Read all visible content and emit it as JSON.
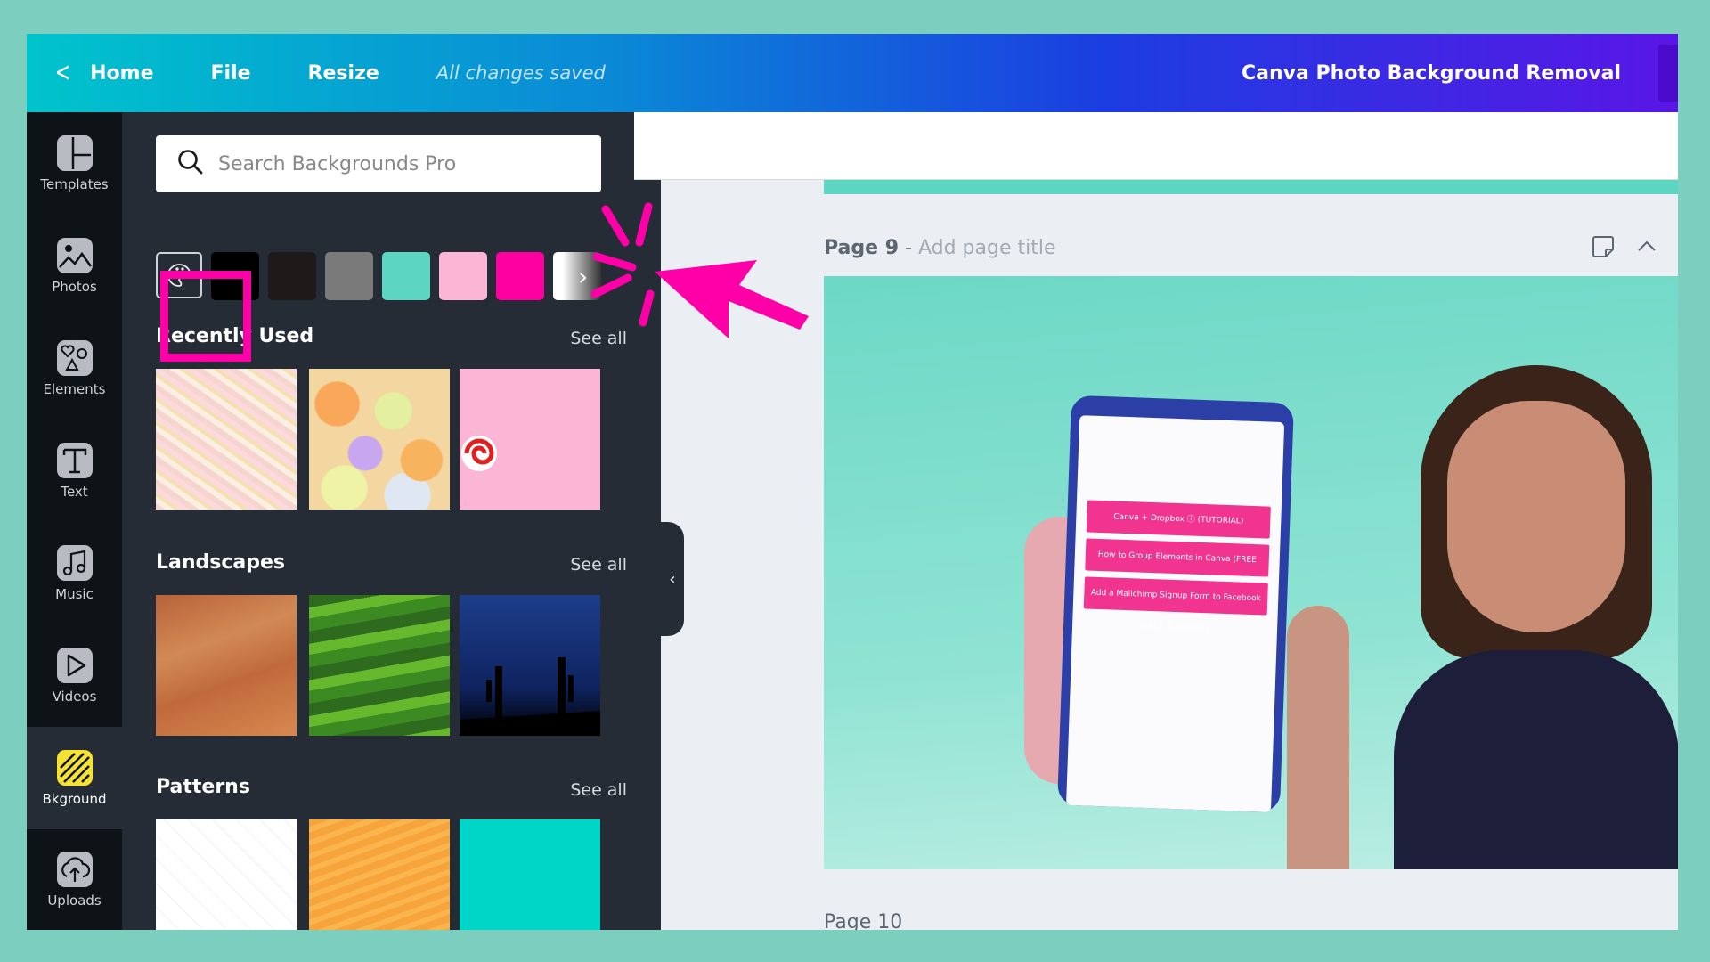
{
  "header": {
    "back_label": "Home",
    "file_label": "File",
    "resize_label": "Resize",
    "save_status": "All changes saved",
    "document_title": "Canva Photo Background Removal"
  },
  "rail": {
    "items": [
      {
        "label": "Templates",
        "icon": "templates-icon"
      },
      {
        "label": "Photos",
        "icon": "photos-icon"
      },
      {
        "label": "Elements",
        "icon": "elements-icon"
      },
      {
        "label": "Text",
        "icon": "text-icon"
      },
      {
        "label": "Music",
        "icon": "music-icon"
      },
      {
        "label": "Videos",
        "icon": "videos-icon"
      },
      {
        "label": "Bkground",
        "icon": "background-icon",
        "active": true
      },
      {
        "label": "Uploads",
        "icon": "uploads-icon"
      }
    ]
  },
  "panel": {
    "search_placeholder": "Search Backgrounds Pro",
    "swatches": [
      {
        "name": "black",
        "color": "#000000"
      },
      {
        "name": "dark-brown",
        "color": "#1e1a1a"
      },
      {
        "name": "gray",
        "color": "#7a7a7a"
      },
      {
        "name": "turquoise",
        "color": "#5cd6c2"
      },
      {
        "name": "light-pink",
        "color": "#fbb6d6"
      },
      {
        "name": "hot-pink",
        "color": "#ff00a0"
      },
      {
        "name": "white-gradient",
        "color": "#ffffff"
      }
    ],
    "sections": [
      {
        "title": "Recently Used",
        "see_all": "See all",
        "thumbnails": [
          "marshmallows",
          "candy-hearts",
          "pink-lollipop"
        ]
      },
      {
        "title": "Landscapes",
        "see_all": "See all",
        "thumbnails": [
          "desert-dunes",
          "green-hills",
          "starry-cactus-night"
        ]
      },
      {
        "title": "Patterns",
        "see_all": "See all",
        "thumbnails": [
          "white-geometric",
          "orange-zigzag",
          "turquoise"
        ]
      }
    ]
  },
  "canvas": {
    "page_label": "Page 9",
    "page_separator": " - ",
    "page_title_placeholder": "Add page title",
    "next_page_label": "Page 10",
    "page_background_color": "#7fdccb",
    "phone_buttons": [
      "Canva + Dropbox ⓘ (TUTORIAL)",
      "How to Group Elements in Canva (FREE TUTORIAL)",
      "Add a Mailchimp Signup Form to Facebook (FREE TUTORIAL)"
    ]
  },
  "annotation": {
    "highlight_color": "#ff00a8"
  }
}
